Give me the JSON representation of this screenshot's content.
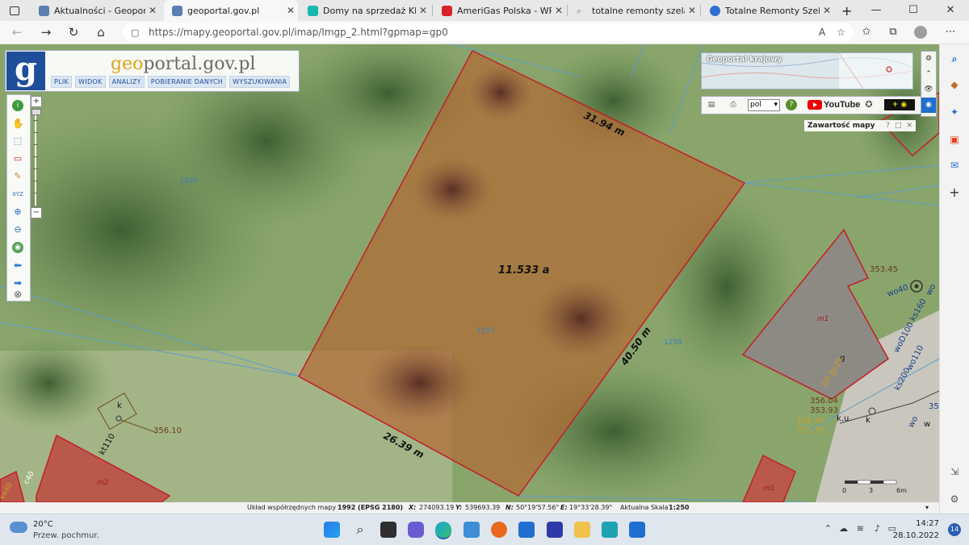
{
  "browser": {
    "tabs": [
      {
        "title": "Aktualności - Geoportal Kra",
        "favicon_color": "#5a7fb0",
        "active": false
      },
      {
        "title": "geoportal.gov.pl",
        "favicon_color": "#5a7fb0",
        "active": true
      },
      {
        "title": "Domy na sprzedaż Klucze, c",
        "favicon_color": "#17b8b0",
        "active": false
      },
      {
        "title": "AmeriGas Polska - WP Pocz",
        "favicon_color": "#d8232a",
        "active": false
      },
      {
        "title": "totalne remonty szelągowsk",
        "favicon_color": "#9aa0a6",
        "active": false
      },
      {
        "title": "Totalne Remonty Szelągows",
        "favicon_color": "#2f6fd1",
        "active": false
      }
    ],
    "new_tab_label": "+",
    "window_controls": {
      "minimize": "—",
      "maximize": "☐",
      "close": "✕"
    },
    "url": "https://mapy.geoportal.gov.pl/imap/Imgp_2.html?gpmap=gp0",
    "read_aloud_label": "A",
    "nav": {
      "back": "←",
      "forward": "→",
      "reload": "↻",
      "home": "⌂"
    }
  },
  "geoportal": {
    "logo_letter": "g",
    "site_name_prefix": "geo",
    "site_name_rest": "portal.gov.pl",
    "menu": [
      "PLIK",
      "WIDOK",
      "ANALIZY",
      "POBIERANIE DANYCH",
      "WYSZUKIWANIA"
    ],
    "minimap_label": "Geoportal krajowy",
    "language": "pol",
    "youtube_label": "YouTube",
    "layers_panel_title": "Zawartość mapy",
    "layers_panel_buttons": [
      "?",
      "□",
      "✕"
    ],
    "zoom_plus": "+",
    "zoom_minus": "−"
  },
  "map": {
    "parcel_area": "11.533 a",
    "edges": {
      "top": "31.94 m",
      "right": "40.50 m",
      "bottom": "26.39 m"
    },
    "labels": {
      "parcel_left_number": "1255",
      "parcel_center_number": "1257",
      "parcel_right_number": "1259",
      "building_m1": "m1",
      "building_m2": "m2",
      "building_m1_bottom": "m1",
      "point_k_left": "k",
      "point_k_right": "k",
      "point_ku": "k.u.",
      "point_g": "g",
      "point_w": "w",
      "kt110": "kt110",
      "wo40": "wo40",
      "ks160": "ks160",
      "woD100": "woD100",
      "ks200": "ks200",
      "wo110": "wo110",
      "wo_right": "wo",
      "wo_bottom": "wo",
      "number_35": "35",
      "code_20gs25": "20 gs25",
      "elev_35345": "353.45",
      "elev_35604": "356.04",
      "elev_35393": "353.93",
      "elev_35638": "356.38",
      "elev_35575": "355.75",
      "elev_35610": "356.10",
      "label_ka40": "ka40",
      "label_c40": "c40"
    },
    "scalebar": {
      "ticks": [
        "0",
        "3",
        "6m"
      ]
    }
  },
  "statusbar": {
    "system_label": "Układ współrzędnych mapy",
    "system_value": "1992 (EPSG 2180)",
    "x_label": "X:",
    "x_value": "274093.19",
    "y_label": "Y:",
    "y_value": "539693.39",
    "n_label": "N:",
    "n_value": "50°19'57.56\"",
    "e_label": "E:",
    "e_value": "19°33'28.39\"",
    "scale_label": "Aktualna Skala",
    "scale_value": "1:250"
  },
  "taskbar": {
    "weather_temp": "20°C",
    "weather_desc": "Przew. pochmur.",
    "time": "14:27",
    "date": "28.10.2022",
    "notifications": "14"
  }
}
